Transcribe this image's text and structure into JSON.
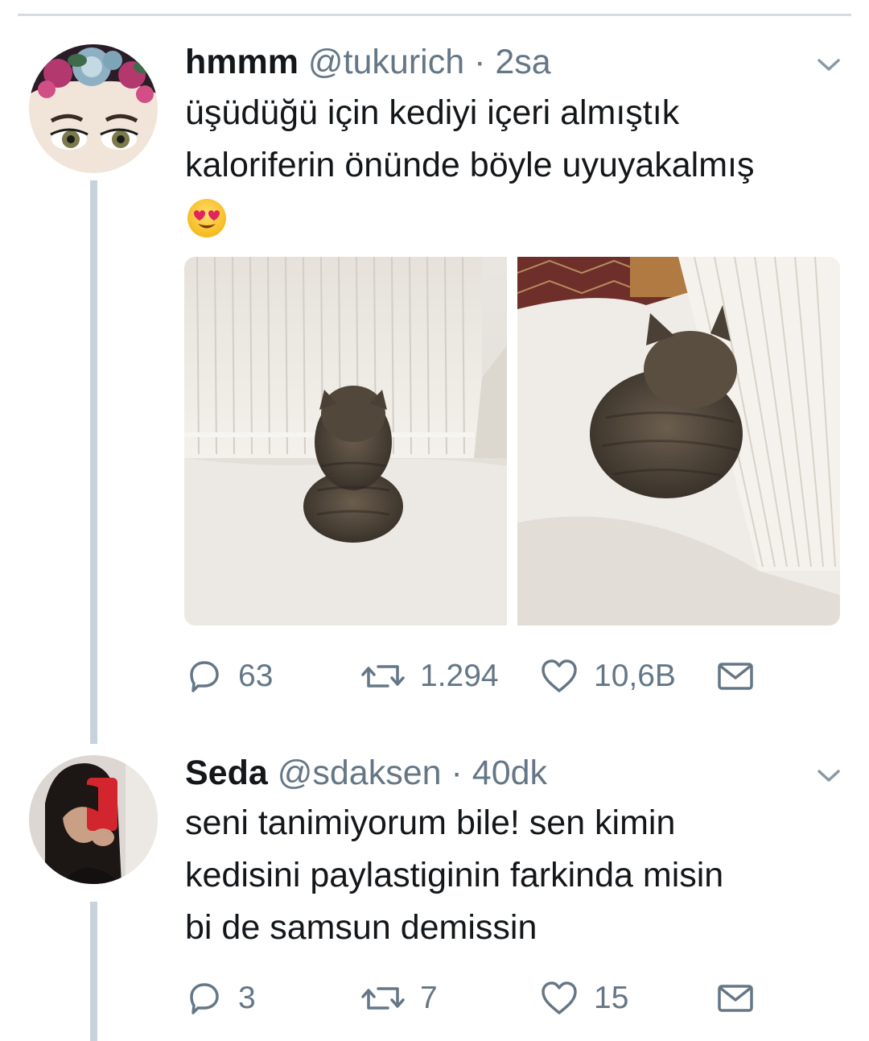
{
  "tweets": [
    {
      "name": "hmmm",
      "handle": "@tukurich",
      "separator": "·",
      "time": "2sa",
      "text_lines": [
        "üşüdüğü için kediyi içeri almıştık",
        "kaloriferin önünde böyle uyuyakalmış"
      ],
      "emoji": "smiling-face-with-heart-eyes",
      "media_count": 2,
      "actions": {
        "reply_count": "63",
        "retweet_count": "1.294",
        "like_count": "10,6B"
      }
    },
    {
      "name": "Seda",
      "handle": "@sdaksen",
      "separator": "·",
      "time": "40dk",
      "text_lines": [
        "seni tanimiyorum bile! sen kimin",
        "kedisini paylastiginin farkinda misin",
        "bi de samsun demissin"
      ],
      "actions": {
        "reply_count": "3",
        "retweet_count": "7",
        "like_count": "15"
      }
    }
  ],
  "colors": {
    "text_primary": "#14171a",
    "text_secondary": "#657786",
    "thread_line": "#c7d3dc",
    "divider": "#d4dbe1"
  },
  "icons": [
    "chevron-down-icon",
    "reply-icon",
    "retweet-icon",
    "like-icon",
    "direct-message-icon"
  ]
}
